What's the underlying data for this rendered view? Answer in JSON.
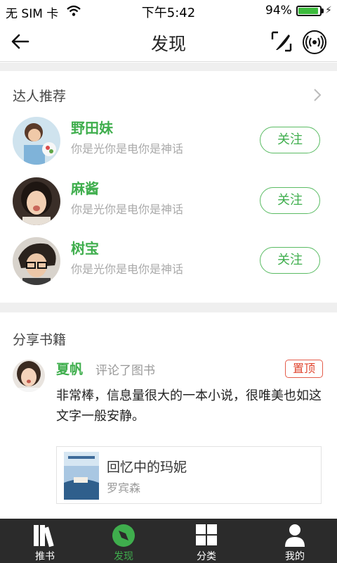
{
  "status_bar": {
    "carrier": "无 SIM 卡",
    "time": "下午5:42",
    "battery_pct": "94%",
    "battery_level": 0.94
  },
  "navbar": {
    "title": "发现"
  },
  "experts": {
    "heading": "达人推荐",
    "users": [
      {
        "name": "野田妹",
        "bio": "你是光你是电你是神话",
        "follow_label": "关注"
      },
      {
        "name": "麻酱",
        "bio": "你是光你是电你是神话",
        "follow_label": "关注"
      },
      {
        "name": "树宝",
        "bio": "你是光你是电你是神话",
        "follow_label": "关注"
      }
    ]
  },
  "share": {
    "heading": "分享书籍",
    "post": {
      "user": "夏帆",
      "action": "评论了图书",
      "badge": "置顶",
      "comment": "非常棒，信息量很大的一本小说，很唯美也如这文字一般安静。",
      "book": {
        "title": "回忆中的玛妮",
        "author": "罗宾森"
      }
    }
  },
  "tabbar": {
    "tabs": [
      {
        "label": "推书",
        "icon": "books-icon"
      },
      {
        "label": "发现",
        "icon": "compass-icon",
        "active": true
      },
      {
        "label": "分类",
        "icon": "grid-icon"
      },
      {
        "label": "我的",
        "icon": "person-icon"
      }
    ]
  },
  "colors": {
    "accent": "#3fae4d",
    "pin": "#e0452f",
    "tabbar": "#2b2b2b",
    "gap": "#efefef"
  }
}
